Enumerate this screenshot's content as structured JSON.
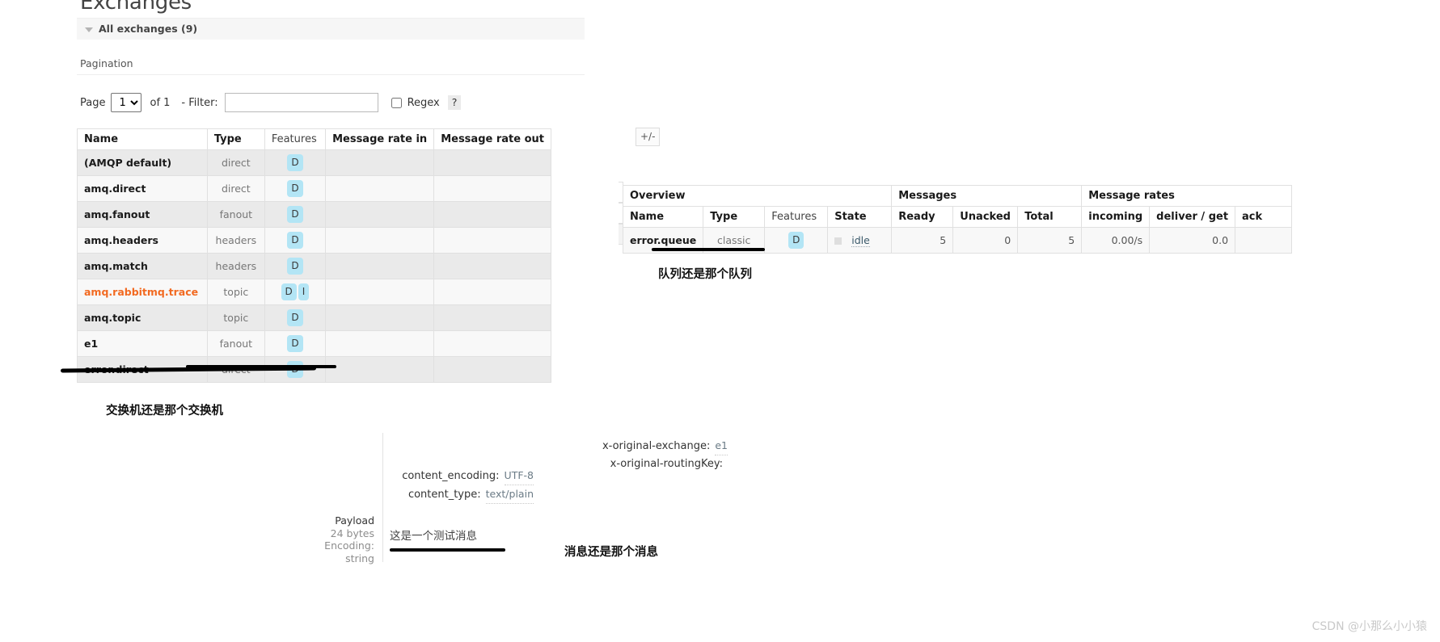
{
  "exchanges": {
    "page_title": "Exchanges",
    "section_label": "All exchanges (9)",
    "pagination_label": "Pagination",
    "pager": {
      "page_label": "Page",
      "page_value": "1",
      "page_options": [
        "1"
      ],
      "of_label": "of 1",
      "filter_label": "- Filter:",
      "filter_value": "",
      "filter_placeholder": "",
      "regex_label": "Regex",
      "regex_checked": false,
      "help_label": "?"
    },
    "columns": [
      "Name",
      "Type",
      "Features",
      "Message rate in",
      "Message rate out"
    ],
    "toggle_columns_label": "+/-",
    "rows": [
      {
        "name": "(AMQP default)",
        "type": "direct",
        "features": [
          "D"
        ],
        "rate_in": "",
        "rate_out": "",
        "internal": false
      },
      {
        "name": "amq.direct",
        "type": "direct",
        "features": [
          "D"
        ],
        "rate_in": "",
        "rate_out": "",
        "internal": false
      },
      {
        "name": "amq.fanout",
        "type": "fanout",
        "features": [
          "D"
        ],
        "rate_in": "",
        "rate_out": "",
        "internal": false
      },
      {
        "name": "amq.headers",
        "type": "headers",
        "features": [
          "D"
        ],
        "rate_in": "",
        "rate_out": "",
        "internal": false
      },
      {
        "name": "amq.match",
        "type": "headers",
        "features": [
          "D"
        ],
        "rate_in": "",
        "rate_out": "",
        "internal": false
      },
      {
        "name": "amq.rabbitmq.trace",
        "type": "topic",
        "features": [
          "D",
          "I"
        ],
        "rate_in": "",
        "rate_out": "",
        "internal": true
      },
      {
        "name": "amq.topic",
        "type": "topic",
        "features": [
          "D"
        ],
        "rate_in": "",
        "rate_out": "",
        "internal": false
      },
      {
        "name": "e1",
        "type": "fanout",
        "features": [
          "D"
        ],
        "rate_in": "",
        "rate_out": "",
        "internal": false
      },
      {
        "name": "error.direct",
        "type": "direct",
        "features": [
          "D"
        ],
        "rate_in": "",
        "rate_out": "",
        "internal": false
      }
    ]
  },
  "queues": {
    "groups": [
      "Overview",
      "Messages",
      "Message rates"
    ],
    "columns": [
      "Name",
      "Type",
      "Features",
      "State",
      "Ready",
      "Unacked",
      "Total",
      "incoming",
      "deliver / get",
      "ack"
    ],
    "rows": [
      {
        "name": "error.queue",
        "type": "classic",
        "features": [
          "D"
        ],
        "state": "idle",
        "ready": "5",
        "unacked": "0",
        "total": "5",
        "incoming": "0.00/s",
        "deliver_get": "0.0",
        "ack": ""
      }
    ]
  },
  "message": {
    "properties_left": [
      {
        "key": "content_encoding:",
        "value": "UTF-8"
      },
      {
        "key": "content_type:",
        "value": "text/plain"
      }
    ],
    "headers_right": [
      {
        "key": "x-original-exchange:",
        "value": "e1"
      },
      {
        "key": "x-original-routingKey:",
        "value": ""
      }
    ],
    "payload_title": "Payload",
    "payload_size": "24 bytes",
    "payload_encoding_label": "Encoding:",
    "payload_encoding": "string",
    "payload_body": "这是一个测试消息"
  },
  "annotations": {
    "exchanges": "交换机还是那个交换机",
    "queues": "队列还是那个队列",
    "message": "消息还是那个消息"
  },
  "watermark": "CSDN @小那么小小猿",
  "colors": {
    "badge_bg": "#b3e5f5",
    "internal_name": "#f26a21",
    "row_alt": "#eaeaea",
    "section_bg": "#f6f6f6"
  }
}
